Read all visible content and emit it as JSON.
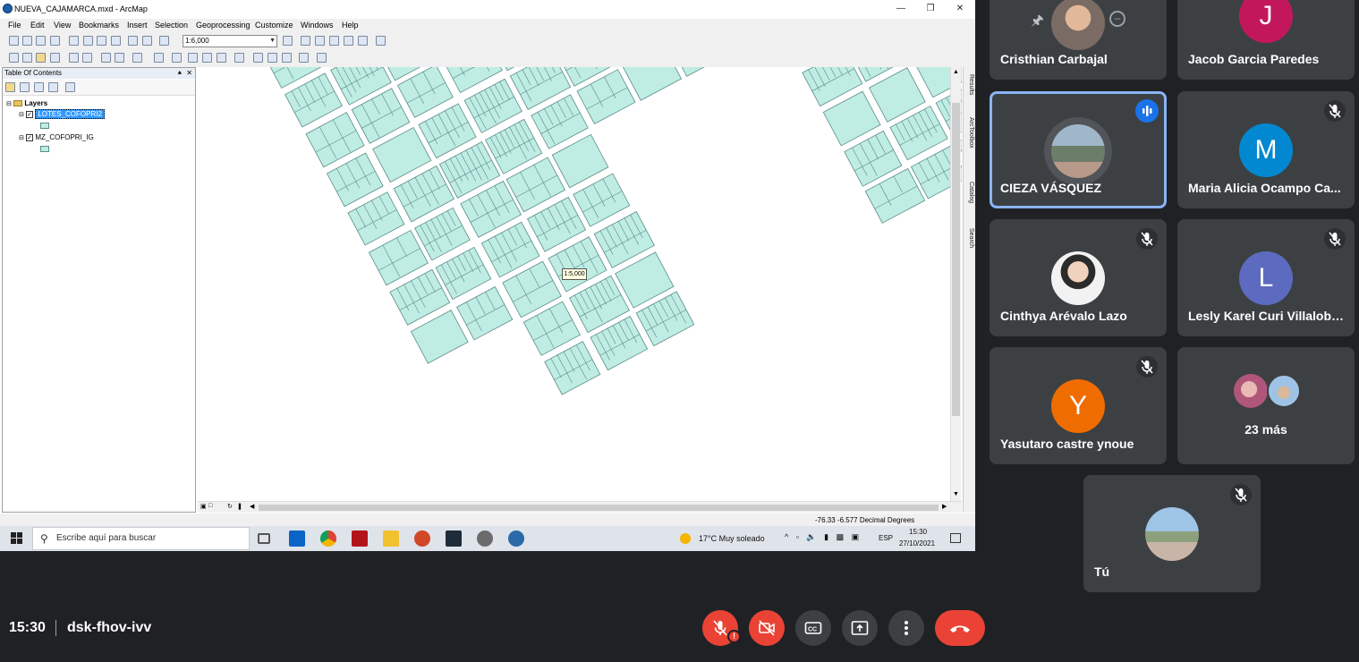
{
  "arcmap": {
    "window_title": "NUEVA_CAJAMARCA.mxd - ArcMap",
    "menu": [
      "File",
      "Edit",
      "View",
      "Bookmarks",
      "Insert",
      "Selection",
      "Geoprocessing",
      "Customize",
      "Windows",
      "Help"
    ],
    "scale_value": "1:6,000",
    "toc_title": "Table Of Contents",
    "layers_root": "Layers",
    "layer_1": "LOTES_COFOPRI2",
    "layer_2": "MZ_COFOPRI_IG",
    "dock_results": "Results",
    "dock_arctoolbox": "ArcToolbox",
    "dock_catalog": "Catalog",
    "dock_search": "Search",
    "map_scale_tip": "1:5,000",
    "status_coords": "-76.33  -6.577 Decimal Degrees",
    "parcel_fill": "#bfece3",
    "parcel_stroke": "#5a8c8a"
  },
  "taskbar": {
    "search_placeholder": "Escribe aquí para buscar",
    "weather": "17°C  Muy soleado",
    "lang": "ESP",
    "time": "15:30",
    "date": "27/10/2021"
  },
  "participants": [
    {
      "name": "Cristhian Carbajal",
      "kind": "photo"
    },
    {
      "name": "Jacob Garcia Paredes",
      "initial": "J",
      "color": "#c2185b"
    },
    {
      "name": "CIEZA VÁSQUEZ",
      "kind": "photo",
      "speaking": true
    },
    {
      "name": "Maria Alicia Ocampo Ca...",
      "initial": "M",
      "color": "#0288d1"
    },
    {
      "name": "Cinthya Arévalo Lazo",
      "kind": "photo"
    },
    {
      "name": "Lesly Karel Curi Villalobos",
      "initial": "L",
      "color": "#5c6bc0"
    },
    {
      "name": "Yasutaro castre ynoue",
      "initial": "Y",
      "color": "#ef6c00"
    },
    {
      "name": "23 más",
      "kind": "more"
    },
    {
      "name": "Tú",
      "kind": "photo"
    }
  ],
  "meet": {
    "clock": "15:30",
    "meeting_code": "dsk-fhov-ivv",
    "accent_red": "#ea4335",
    "tile_bg": "#3c4043",
    "speaking_border": "#8ab4f8"
  }
}
